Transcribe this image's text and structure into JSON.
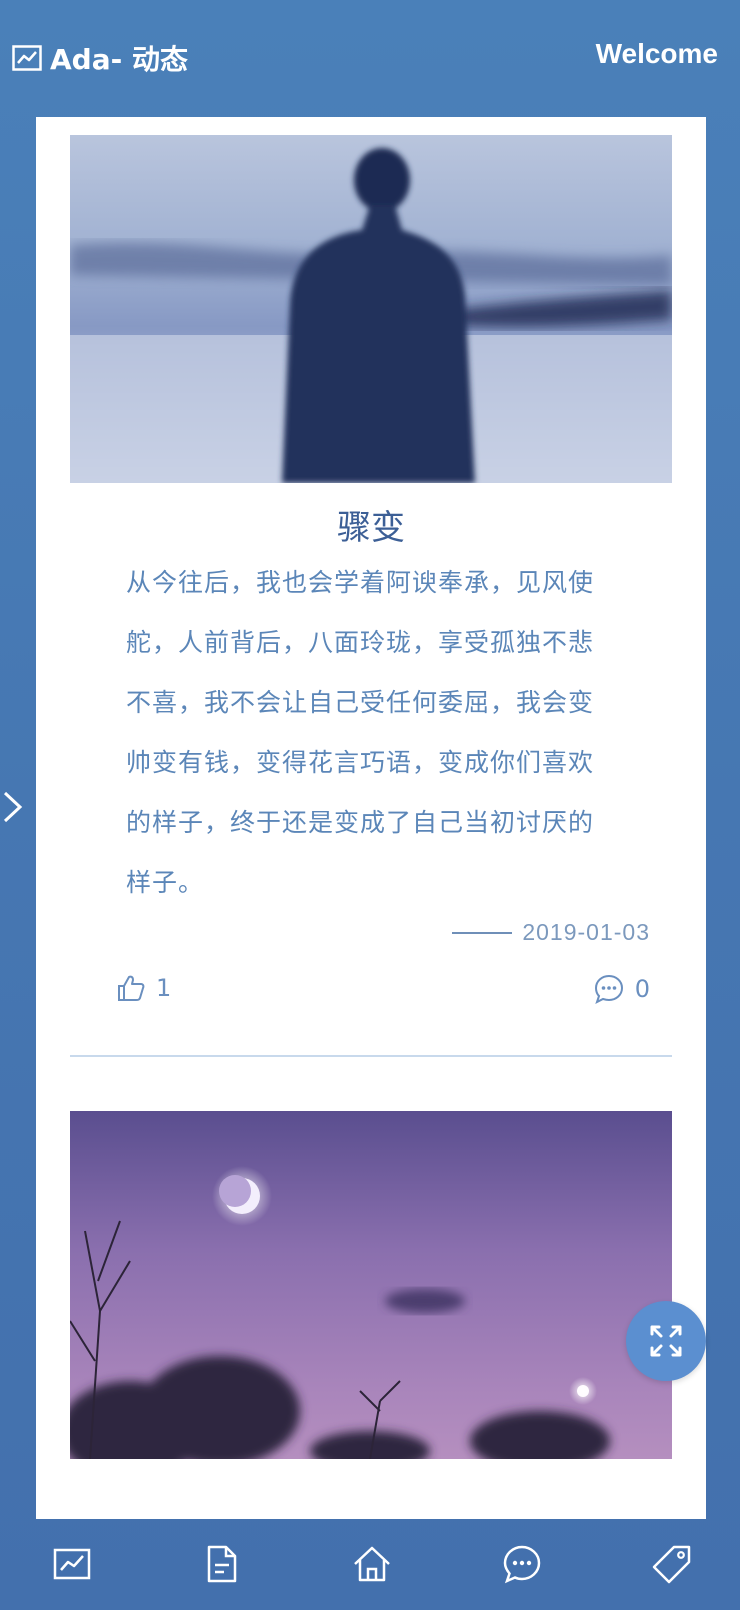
{
  "header": {
    "title": "Ada- 动态",
    "welcome": "Welcome",
    "title_icon": "chart-line-icon"
  },
  "posts": [
    {
      "image": "blurred-figure-at-sea-photo",
      "title": "骤变",
      "content": "从今往后，我也会学着阿谀奉承，见风使舵，人前背后，八面玲珑，享受孤独不悲不喜，我不会让自己受任何委屈，我会变帅变有钱，变得花言巧语，变成你们喜欢的样子，终于还是变成了自己当初讨厌的样子。",
      "date": "2019-01-03",
      "likes": "1",
      "comments": "0"
    },
    {
      "image": "purple-night-sky-moon-photo"
    }
  ],
  "fab": {
    "icon": "expand-icon"
  },
  "bottom_nav": [
    {
      "icon": "chart-line-icon"
    },
    {
      "icon": "document-icon"
    },
    {
      "icon": "home-icon"
    },
    {
      "icon": "chat-bubble-icon"
    },
    {
      "icon": "tag-icon"
    }
  ],
  "colors": {
    "background": "#4a7fb8",
    "accent": "#5b8fd0",
    "title_text": "#3c5f96",
    "body_text": "#5b86b8"
  }
}
